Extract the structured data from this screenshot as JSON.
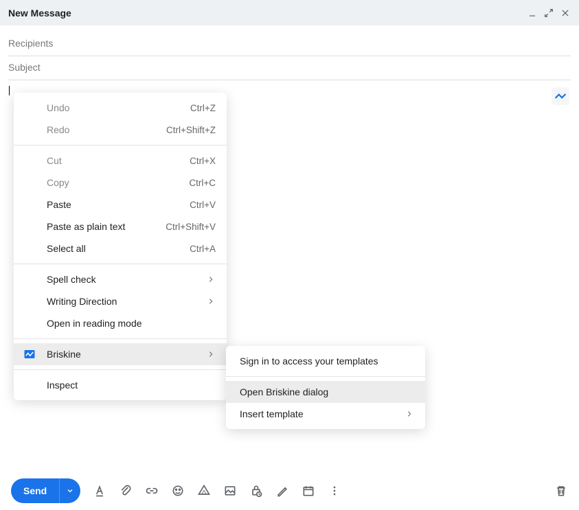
{
  "window": {
    "title": "New Message"
  },
  "fields": {
    "recipients_placeholder": "Recipients",
    "subject_placeholder": "Subject"
  },
  "context_menu": {
    "undo": {
      "label": "Undo",
      "shortcut": "Ctrl+Z"
    },
    "redo": {
      "label": "Redo",
      "shortcut": "Ctrl+Shift+Z"
    },
    "cut": {
      "label": "Cut",
      "shortcut": "Ctrl+X"
    },
    "copy": {
      "label": "Copy",
      "shortcut": "Ctrl+C"
    },
    "paste": {
      "label": "Paste",
      "shortcut": "Ctrl+V"
    },
    "paste_plain": {
      "label": "Paste as plain text",
      "shortcut": "Ctrl+Shift+V"
    },
    "select_all": {
      "label": "Select all",
      "shortcut": "Ctrl+A"
    },
    "spell_check": {
      "label": "Spell check"
    },
    "writing_direction": {
      "label": "Writing Direction"
    },
    "reading_mode": {
      "label": "Open in reading mode"
    },
    "briskine": {
      "label": "Briskine"
    },
    "inspect": {
      "label": "Inspect"
    }
  },
  "submenu": {
    "sign_in": {
      "label": "Sign in to access your templates"
    },
    "open_dialog": {
      "label": "Open Briskine dialog"
    },
    "insert_template": {
      "label": "Insert template"
    }
  },
  "toolbar": {
    "send_label": "Send"
  }
}
